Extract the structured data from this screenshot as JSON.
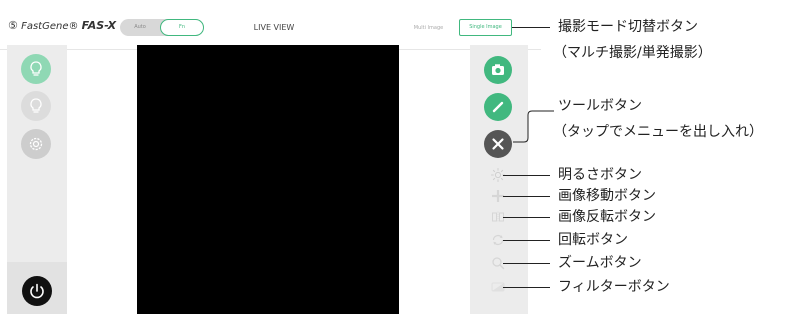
{
  "header": {
    "logo_symbol": "⑤",
    "logo_brand": "FastGene®",
    "logo_model": "FAS-X",
    "mode_auto": "Auto",
    "mode_fn": "Fn",
    "title": "LIVE VIEW",
    "multi_image": "Multi Image",
    "single_image": "Single Image"
  },
  "annotations": [
    "撮影モード切替ボタン",
    "（マルチ撮影/単発撮影）",
    "ツールボタン",
    "（タップでメニューを出し入れ）",
    "明るさボタン",
    "画像移動ボタン",
    "画像反転ボタン",
    "回転ボタン",
    "ズームボタン",
    "フィルターボタン"
  ],
  "colors": {
    "accent_green": "#41b87f",
    "light_green": "#8fd8b4",
    "panel_gray": "#ececec",
    "dark_gray": "#555555",
    "tool_icon_gray": "#cfcfcf"
  }
}
